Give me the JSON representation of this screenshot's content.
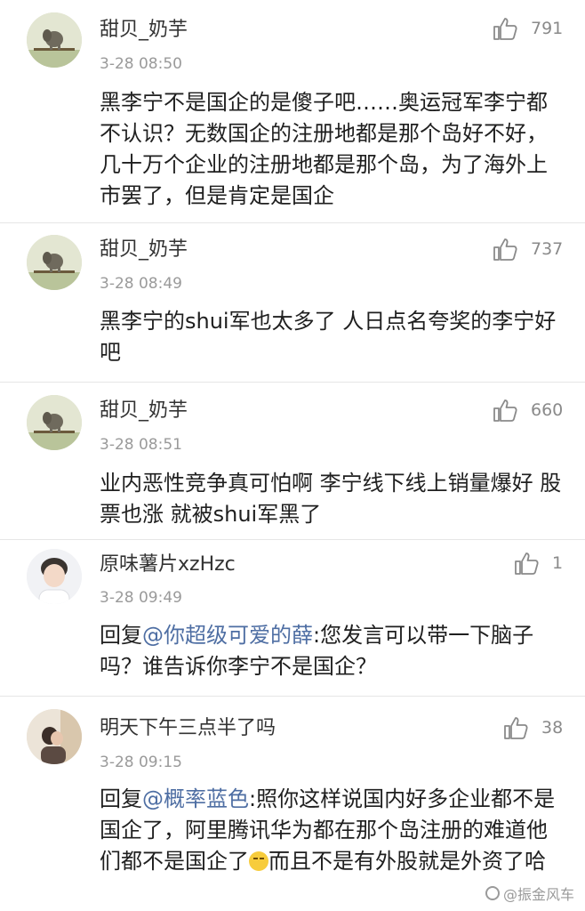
{
  "comments": [
    {
      "username": "甜贝_奶芋",
      "time": "3-28 08:50",
      "likes": "791",
      "text": "黑李宁不是国企的是傻子吧……奥运冠军李宁都不认识？无数国企的注册地都是那个岛好不好，几十万个企业的注册地都是那个岛，为了海外上市罢了，但是肯定是国企",
      "avatar": "elephant-avatar"
    },
    {
      "username": "甜贝_奶芋",
      "time": "3-28 08:49",
      "likes": "737",
      "text": "黑李宁的shui军也太多了 人日点名夸奖的李宁好吧",
      "avatar": "elephant-avatar"
    },
    {
      "username": "甜贝_奶芋",
      "time": "3-28 08:51",
      "likes": "660",
      "text": "业内恶性竞争真可怕啊  李宁线下线上销量爆好  股票也涨  就被shui军黑了",
      "avatar": "elephant-avatar"
    },
    {
      "username": "原味薯片xzHzc",
      "time": "3-28 09:49",
      "likes": "1",
      "reply_prefix": "回复",
      "mention": "@你超级可爱的薛",
      "text": ":您发言可以带一下脑子吗？谁告诉你李宁不是国企？",
      "avatar": "boy-avatar"
    },
    {
      "username": "明天下午三点半了吗",
      "time": "3-28 09:15",
      "likes": "38",
      "reply_prefix": "回复",
      "mention": "@概率蓝色",
      "text": ":照你这样说国内好多企业都不是国企了，阿里腾讯华为都在那个岛注册的难道他们都不是国企了",
      "text_after_emoji": "而且不是有外股就是外资了哈",
      "avatar": "couple-avatar"
    }
  ],
  "watermark": "@振金风车",
  "colors": {
    "mention": "#4e6ea3",
    "meta": "#9a9a9a",
    "divider": "#e6e6e6"
  }
}
